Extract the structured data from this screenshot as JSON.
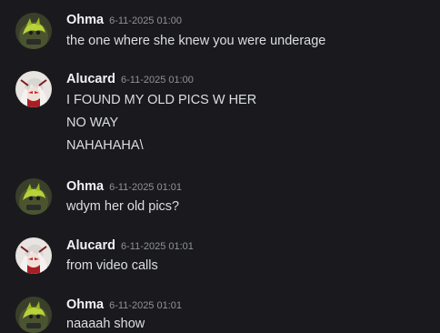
{
  "messages": [
    {
      "author": "Ohma",
      "timestamp": "6-11-2025 01:00",
      "avatar_icon": "ohma-avatar-icon",
      "lines": [
        "the one where she knew you were underage"
      ]
    },
    {
      "author": "Alucard",
      "timestamp": "6-11-2025 01:00",
      "avatar_icon": "alucard-avatar-icon",
      "lines": [
        "I FOUND MY OLD PICS W HER",
        "NO WAY",
        "NAHAHAHA\\"
      ]
    },
    {
      "author": "Ohma",
      "timestamp": "6-11-2025 01:01",
      "avatar_icon": "ohma-avatar-icon",
      "lines": [
        "wdym her old pics?"
      ]
    },
    {
      "author": "Alucard",
      "timestamp": "6-11-2025 01:01",
      "avatar_icon": "alucard-avatar-icon",
      "lines": [
        "from video calls"
      ]
    },
    {
      "author": "Ohma",
      "timestamp": "6-11-2025 01:01",
      "avatar_icon": "ohma-avatar-icon",
      "lines": [
        "naaaah show"
      ]
    }
  ],
  "colors": {
    "background": "#1a1a1e",
    "author": "#f2f3f5",
    "timestamp": "#8e9297",
    "text": "#dbdee1"
  }
}
